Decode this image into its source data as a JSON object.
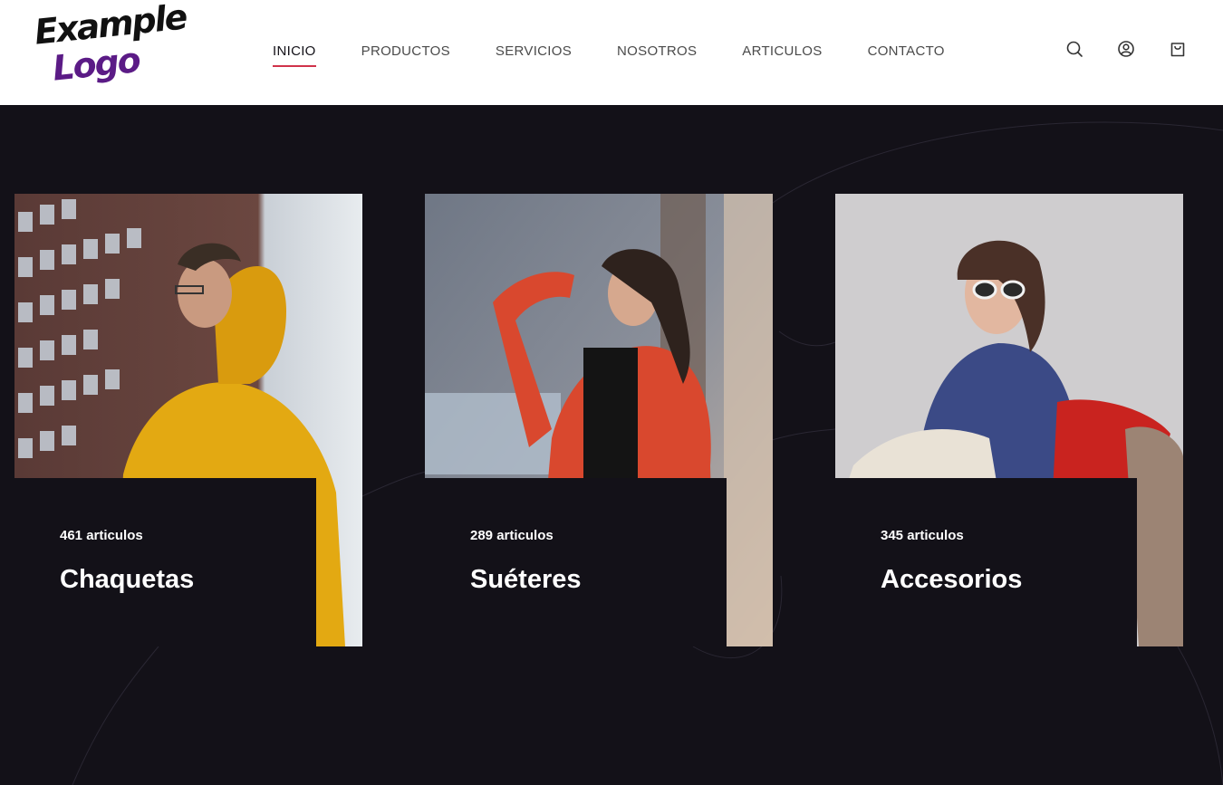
{
  "logo": {
    "line1": "Example",
    "line2": "Logo"
  },
  "nav": {
    "items": [
      {
        "label": "INICIO",
        "active": true
      },
      {
        "label": "PRODUCTOS",
        "active": false
      },
      {
        "label": "SERVICIOS",
        "active": false
      },
      {
        "label": "NOSOTROS",
        "active": false
      },
      {
        "label": "ARTICULOS",
        "active": false
      },
      {
        "label": "CONTACTO",
        "active": false
      }
    ]
  },
  "header_icons": [
    "search-icon",
    "user-icon",
    "cart-icon"
  ],
  "categories": [
    {
      "count": "461 articulos",
      "title": "Chaquetas",
      "image": "man-yellow-hoodie-photo"
    },
    {
      "count": "289 articulos",
      "title": "Suéteres",
      "image": "woman-red-coat-photo"
    },
    {
      "count": "345 articulos",
      "title": "Accesorios",
      "image": "woman-sunglasses-scarves-photo"
    }
  ],
  "colors": {
    "background": "#131118",
    "header": "#ffffff",
    "accent": "#d0334a",
    "logo_purple": "#5b1b86"
  }
}
